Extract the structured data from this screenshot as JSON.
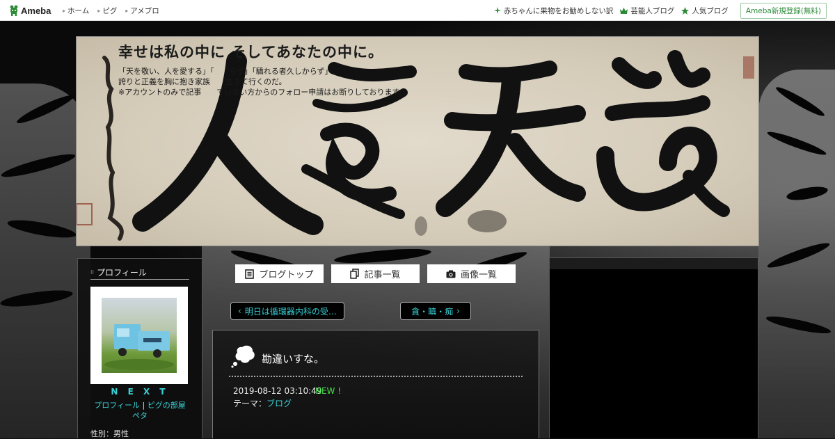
{
  "topbar": {
    "logo_text": "Ameba",
    "nav_left": [
      {
        "label": "ホーム"
      },
      {
        "label": "ピグ"
      },
      {
        "label": "アメブロ"
      }
    ],
    "nav_right": [
      {
        "label": "赤ちゃんに果物をお勧めしない訳",
        "icon": "sparkle-icon"
      },
      {
        "label": "芸能人ブログ",
        "icon": "crown-icon"
      },
      {
        "label": "人気ブログ",
        "icon": "star-icon"
      }
    ],
    "register_label": "Ameba新規登録(無料)"
  },
  "header": {
    "title": "幸せは私の中に そしてあなたの中に。",
    "description": [
      "「天を敬い、人を愛する」「　　らず」「驕れる者久しからず」",
      "誇りと正義を胸に抱き家族　　生きて行くのだ。",
      "※アカウントのみで記事　　ていない方からのフォロー申請はお断りしております。"
    ]
  },
  "sidebar": {
    "title": "プロフィール",
    "nickname": "N E X T",
    "link_profile": "プロフィール",
    "link_separator": "|",
    "link_pig": "ピグの部屋",
    "link_peta": "ペタ",
    "gender": "性別：男性"
  },
  "tabs": [
    {
      "label": "ブログトップ",
      "icon": "list-icon"
    },
    {
      "label": "記事一覧",
      "icon": "documents-icon"
    },
    {
      "label": "画像一覧",
      "icon": "camera-icon"
    }
  ],
  "pager": {
    "prev_label": "明日は循環器内科の受…",
    "next_label": "貪・瞋・痴"
  },
  "article": {
    "title": "勘違いすな。",
    "date": "2019-08-12 03:10:49",
    "new_label": "NEW !",
    "theme_prefix": "テーマ：",
    "theme_link": "ブログ"
  },
  "colors": {
    "link": "#3ad1d6",
    "new": "#44e04a",
    "ameba_green": "#2d8b38"
  }
}
